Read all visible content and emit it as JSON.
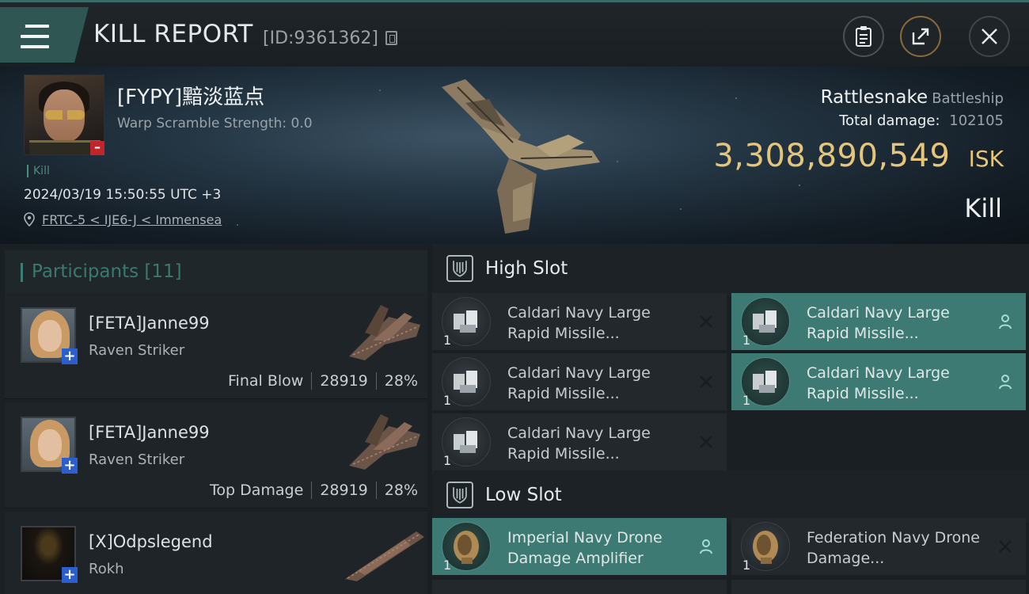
{
  "header": {
    "title": "KILL REPORT",
    "kill_id": "[ID:9361362]"
  },
  "victim": {
    "name": "[FYPY]黯淡蓝点",
    "warp_scramble": "Warp Scramble Strength: 0.0",
    "tag": "Kill",
    "timestamp": "2024/03/19 15:50:55 UTC +3",
    "location": "FRTC-5 < IJE6-J < Immensea",
    "ship_name": "Rattlesnake",
    "ship_class": "Battleship",
    "total_damage_label": "Total damage:",
    "total_damage": "102105",
    "isk_value": "3,308,890,549",
    "isk_unit": "ISK",
    "result": "Kill"
  },
  "participants": {
    "title": "Participants [11]",
    "rows": [
      {
        "name": "[FETA]Janne99",
        "ship": "Raven Striker",
        "role": "Final Blow",
        "damage": "28919",
        "percent": "28%"
      },
      {
        "name": "[FETA]Janne99",
        "ship": "Raven Striker",
        "role": "Top Damage",
        "damage": "28919",
        "percent": "28%"
      },
      {
        "name": "[X]Odpslegend",
        "ship": "Rokh",
        "role": "",
        "damage": "",
        "percent": ""
      }
    ]
  },
  "slots": {
    "high": {
      "title": "High Slot",
      "modules": [
        {
          "name": "Caldari Navy Large Rapid Missile...",
          "qty": "1",
          "state": "destroyed"
        },
        {
          "name": "Caldari Navy Large Rapid Missile...",
          "qty": "1",
          "state": "dropped"
        },
        {
          "name": "Caldari Navy Large Rapid Missile...",
          "qty": "1",
          "state": "destroyed"
        },
        {
          "name": "Caldari Navy Large Rapid Missile...",
          "qty": "1",
          "state": "dropped"
        },
        {
          "name": "Caldari Navy Large Rapid Missile...",
          "qty": "1",
          "state": "destroyed"
        }
      ]
    },
    "low": {
      "title": "Low Slot",
      "modules": [
        {
          "name": "Imperial Navy Drone Damage Amplifier",
          "qty": "1",
          "state": "dropped"
        },
        {
          "name": "Federation Navy Drone Damage...",
          "qty": "1",
          "state": "destroyed"
        }
      ]
    }
  },
  "colors": {
    "accent": "#3e7a74",
    "isk": "#e5c57a",
    "destroyed_badge": "#c0252b",
    "attacker_badge": "#2b5fd0"
  },
  "icons": [
    "menu-icon",
    "copy-icon",
    "clipboard-icon",
    "share-icon",
    "close-icon",
    "location-pin-icon",
    "high-slot-icon",
    "low-slot-icon",
    "destroyed-x-icon",
    "dropped-person-icon"
  ]
}
